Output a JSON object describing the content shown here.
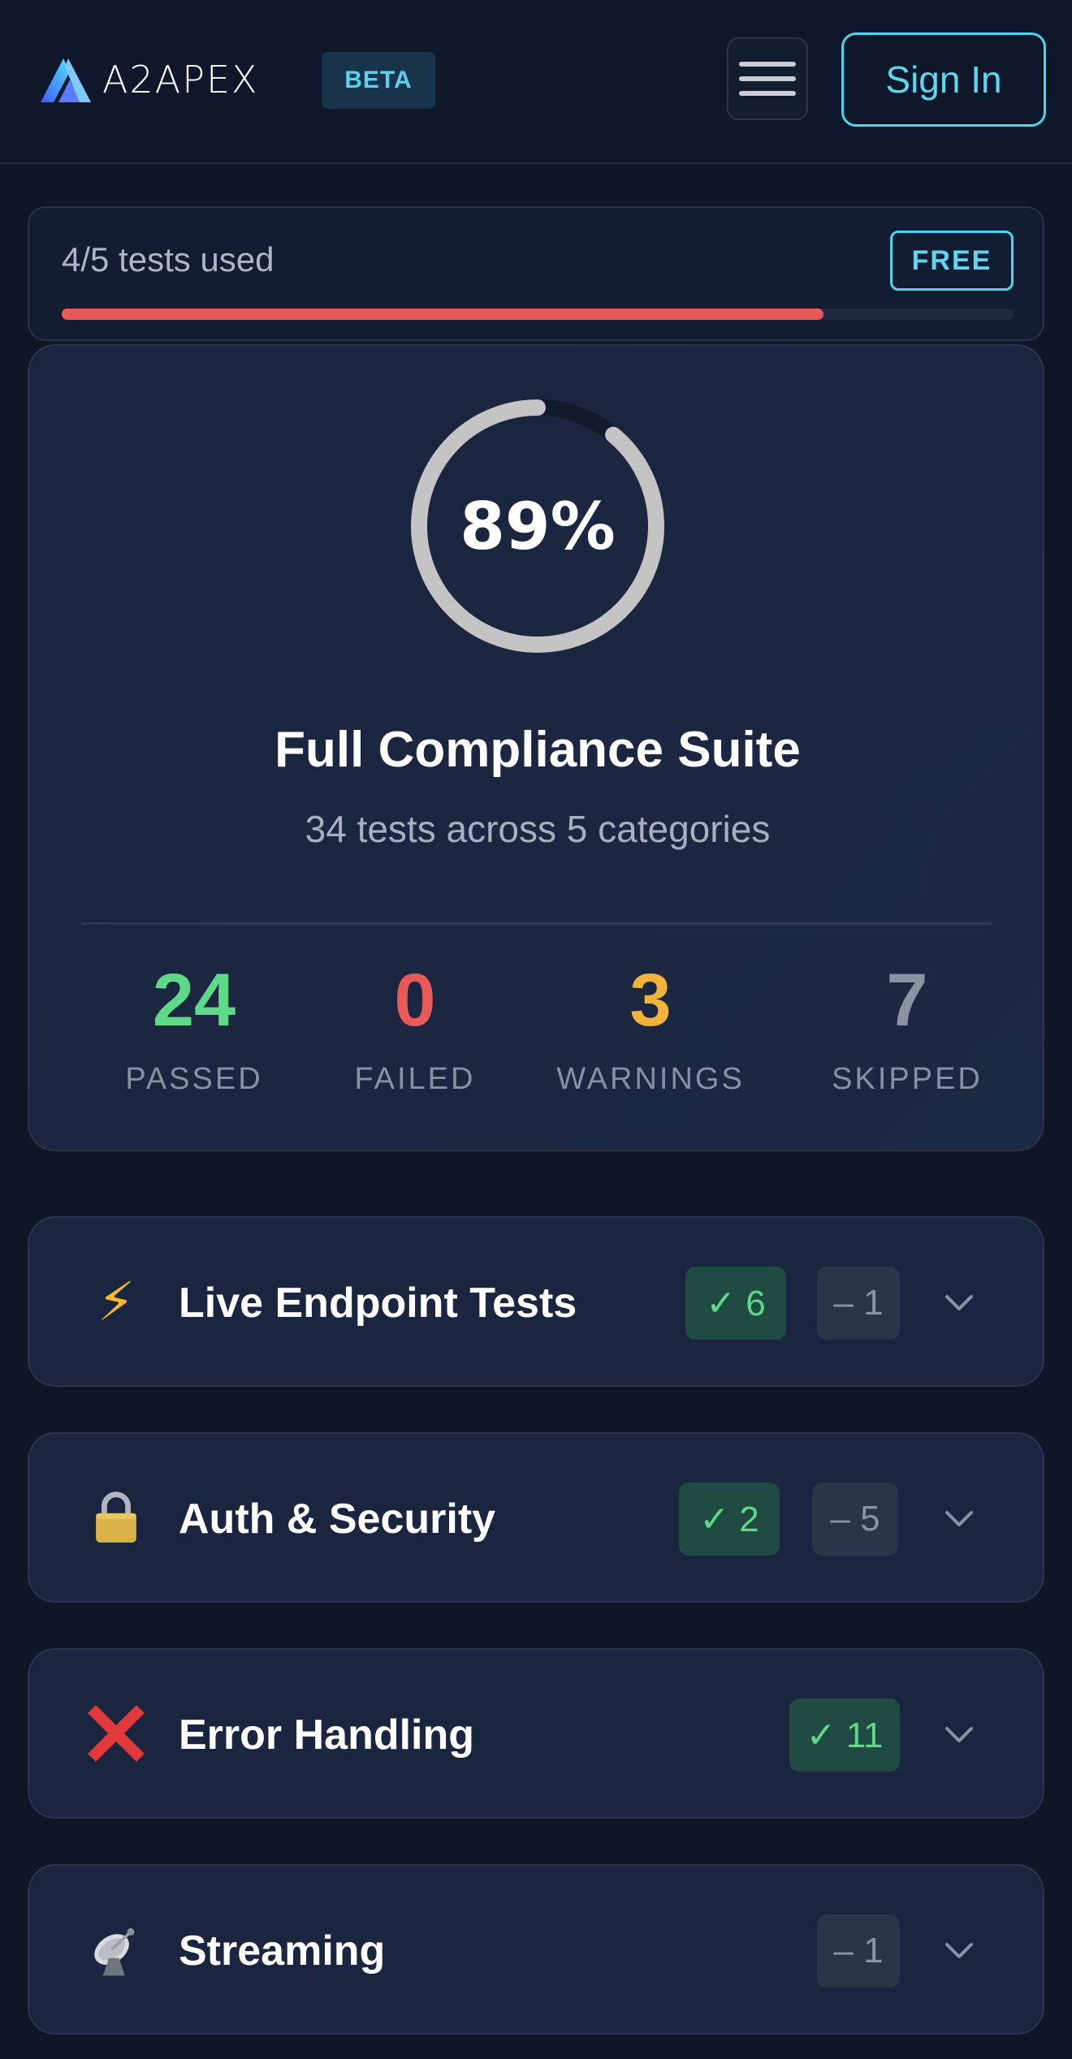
{
  "header": {
    "brand": "A2APEX",
    "beta_label": "BETA",
    "sign_in_label": "Sign In"
  },
  "usage": {
    "text": "4/5 tests used",
    "plan_label": "FREE",
    "fraction_used": 0.8
  },
  "score": {
    "percent_label": "89%",
    "percent": 89,
    "title": "Full Compliance Suite",
    "subtitle": "34 tests across 5 categories",
    "stats": [
      {
        "value": "24",
        "label": "PASSED",
        "color": "#5ed987"
      },
      {
        "value": "0",
        "label": "FAILED",
        "color": "#e85a5a"
      },
      {
        "value": "3",
        "label": "WARNINGS",
        "color": "#f0b43c"
      },
      {
        "value": "7",
        "label": "SKIPPED",
        "color": "#8a93a3"
      }
    ]
  },
  "categories": [
    {
      "icon": "lightning-icon",
      "glyph": "⚡",
      "name": "Live Endpoint Tests",
      "passed": "✓ 6",
      "skipped": "– 1"
    },
    {
      "icon": "lock-icon",
      "glyph": "🔒",
      "name": "Auth & Security",
      "passed": "✓ 2",
      "skipped": "– 5"
    },
    {
      "icon": "cross-icon",
      "glyph": "✕",
      "name": "Error Handling",
      "passed": "✓ 11",
      "skipped": ""
    },
    {
      "icon": "satellite-dish-icon",
      "glyph": "📡",
      "name": "Streaming",
      "passed": "",
      "skipped": "– 1"
    }
  ],
  "colors": {
    "accent": "#4fd2ee",
    "background": "#0e1628",
    "card": "#1a2640",
    "progress": "#e85a5a"
  }
}
